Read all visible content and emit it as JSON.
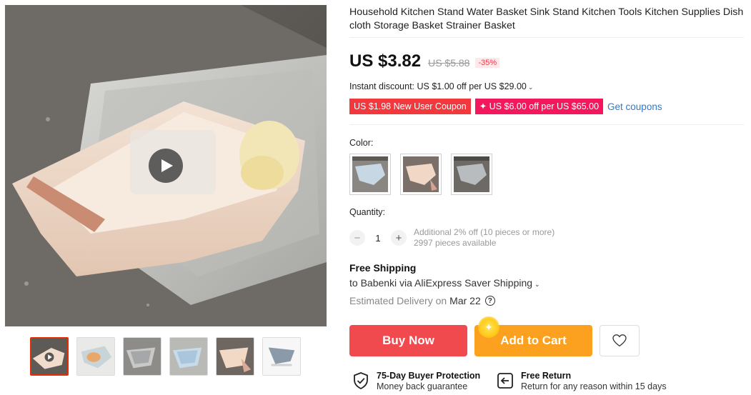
{
  "product": {
    "title": "Household Kitchen Stand Water Basket Sink Stand Kitchen Tools Kitchen Supplies Dishcloth Storage Basket Strainer Basket"
  },
  "gallery": {
    "play_icon": "play-icon",
    "thumbnail_count": 6
  },
  "pricing": {
    "price": "US $3.82",
    "original_price": "US $5.88",
    "discount": "-35%",
    "instant_discount": "Instant discount: US $1.00 off per US $29.00"
  },
  "coupons": {
    "new_user": "US $1.98 New User Coupon",
    "store": "✦ US $6.00 off per US $65.00",
    "get_coupons": "Get coupons"
  },
  "color": {
    "label": "Color:"
  },
  "quantity": {
    "label": "Quantity:",
    "minus": "−",
    "value": "1",
    "plus": "+",
    "note_line1": "Additional 2% off (10 pieces or more)",
    "note_line2": "2997 pieces available"
  },
  "shipping": {
    "title": "Free Shipping",
    "to": "to Babenki via AliExpress Saver Shipping",
    "estimated_label": "Estimated Delivery on",
    "date": "Mar 22",
    "help": "?"
  },
  "actions": {
    "buy_now": "Buy Now",
    "add_to_cart": "Add to Cart",
    "wishlist_icon": "heart-icon"
  },
  "guarantees": {
    "protection_title": "75-Day Buyer Protection",
    "protection_sub": "Money back guarantee",
    "return_title": "Free Return",
    "return_sub": "Return for any reason within 15 days"
  },
  "colors": {
    "price_red": "#f04a4f",
    "cart_orange": "#fca11f",
    "coupon_red": "#f0383d",
    "coupon_pink": "#f5175e",
    "link_blue": "#2e7ad1",
    "thumb_active": "#e62e04"
  }
}
